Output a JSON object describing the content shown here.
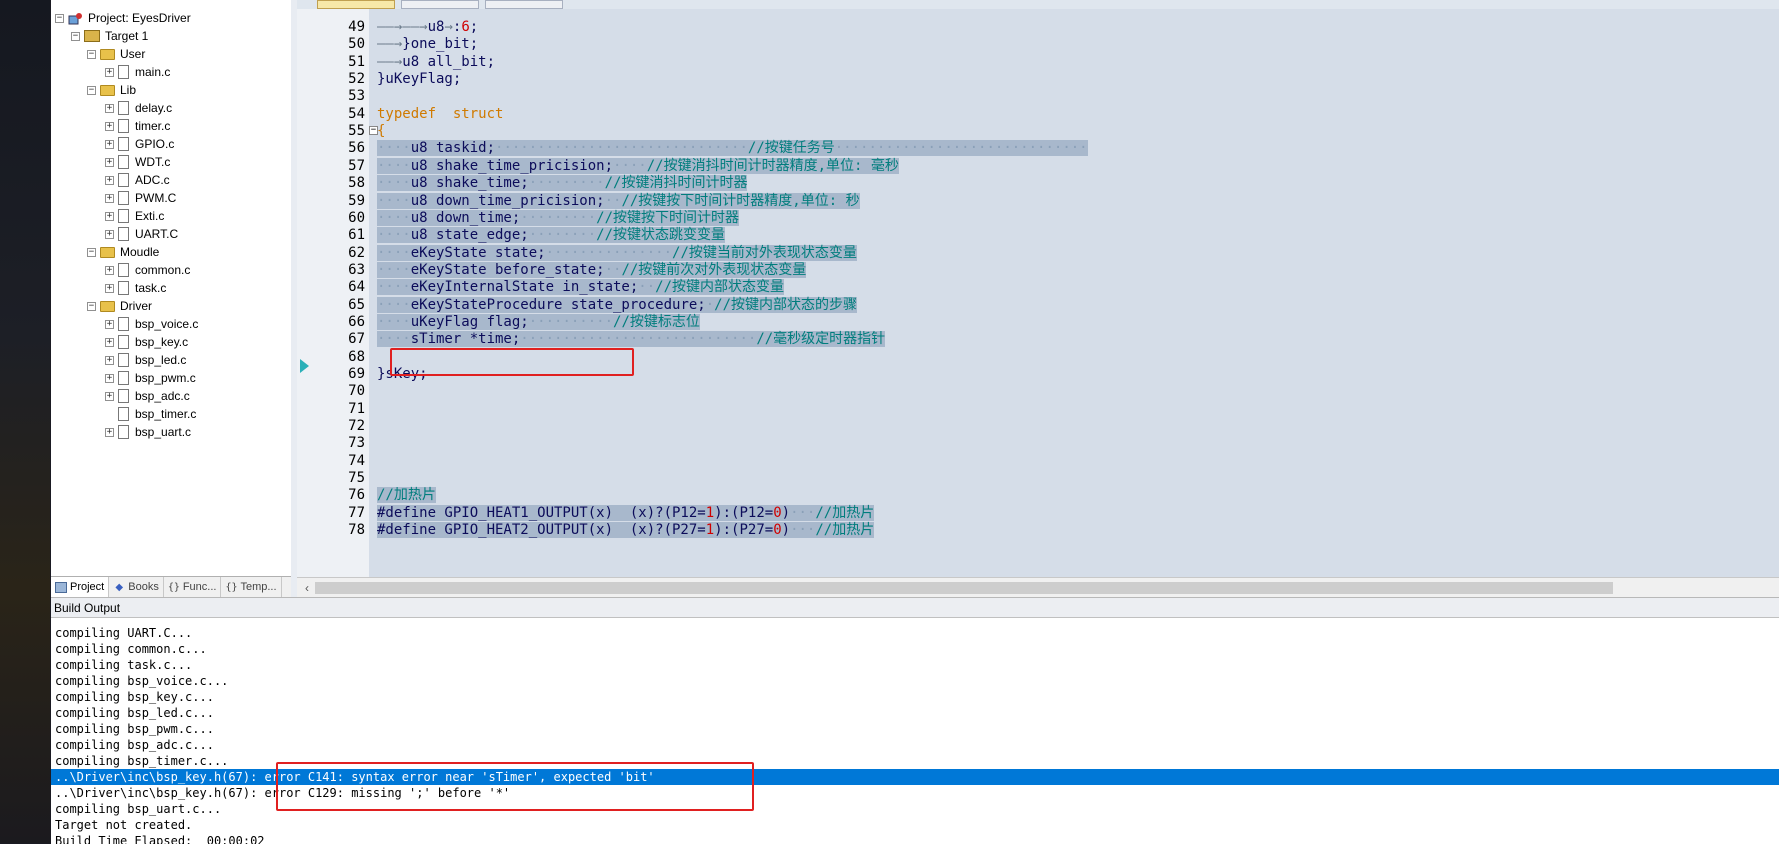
{
  "project": {
    "root_label": "Project: EyesDriver",
    "target_label": "Target 1",
    "groups": [
      {
        "name": "User",
        "files": [
          "main.c"
        ]
      },
      {
        "name": "Lib",
        "files": [
          "delay.c",
          "timer.c",
          "GPIO.c",
          "WDT.c",
          "ADC.c",
          "PWM.C",
          "Exti.c",
          "UART.C"
        ]
      },
      {
        "name": "Moudle",
        "files": [
          "common.c",
          "task.c"
        ]
      },
      {
        "name": "Driver",
        "files": [
          "bsp_voice.c",
          "bsp_key.c",
          "bsp_led.c",
          "bsp_pwm.c",
          "bsp_adc.c",
          "bsp_timer.c",
          "bsp_uart.c"
        ]
      }
    ],
    "tabs": [
      "Project",
      "Books",
      "Func...",
      "Temp..."
    ]
  },
  "editor": {
    "line_numbers": [
      "49",
      "50",
      "51",
      "52",
      "53",
      "54",
      "55",
      "56",
      "57",
      "58",
      "59",
      "60",
      "61",
      "62",
      "63",
      "64",
      "65",
      "66",
      "67",
      "68",
      "69",
      "70",
      "71",
      "72",
      "73",
      "74",
      "75",
      "76",
      "77",
      "78"
    ],
    "lines": {
      "l49": {
        "code": "u8",
        "op": ":",
        "num": "6",
        "end": ";"
      },
      "l50": {
        "code": "}one_bit;"
      },
      "l51": {
        "code": "u8 all_bit;"
      },
      "l52": {
        "code": "}uKeyFlag;"
      },
      "l54": {
        "kw1": "typedef",
        "kw2": "struct"
      },
      "l55": {
        "code": "{"
      },
      "l56": {
        "code": "u8 taskid;",
        "comment": "//按键任务号"
      },
      "l57": {
        "code": "u8 shake_time_pricision;",
        "comment": "//按键消抖时间计时器精度,单位: 毫秒"
      },
      "l58": {
        "code": "u8 shake_time;",
        "comment": "//按键消抖时间计时器"
      },
      "l59": {
        "code": "u8 down_time_pricision;",
        "comment": "//按键按下时间计时器精度,单位: 秒"
      },
      "l60": {
        "code": "u8 down_time;",
        "comment": "//按键按下时间计时器"
      },
      "l61": {
        "code": "u8 state_edge;",
        "comment": "//按键状态跳变变量"
      },
      "l62": {
        "code": "eKeyState state;",
        "comment": "//按键当前对外表现状态变量"
      },
      "l63": {
        "code": "eKeyState before_state;",
        "comment": "//按键前次对外表现状态变量"
      },
      "l64": {
        "code": "eKeyInternalState in_state;",
        "comment": "//按键内部状态变量"
      },
      "l65": {
        "code": "eKeyStateProcedure state_procedure;",
        "comment": "//按键内部状态的步骤"
      },
      "l66": {
        "code": "uKeyFlag flag;",
        "comment": "//按键标志位"
      },
      "l67": {
        "code": "sTimer *time;",
        "comment": "//毫秒级定时器指针"
      },
      "l69": {
        "code": "}sKey;"
      },
      "l76": {
        "comment": "//加热片"
      },
      "l77": {
        "define": "#define GPIO_HEAT1_OUTPUT(x)  (x)?(P12=",
        "n1": "1",
        "mid": "):(P12=",
        "n2": "0",
        "end": ")",
        "comment": "//加热片"
      },
      "l78": {
        "define": "#define GPIO_HEAT2_OUTPUT(x)  (x)?(P27=",
        "n1": "1",
        "mid": "):(P27=",
        "n2": "0",
        "end": ")",
        "comment": "//加热片"
      }
    }
  },
  "build_output": {
    "title": "Build Output",
    "lines": [
      "compiling UART.C...",
      "compiling common.c...",
      "compiling task.c...",
      "compiling bsp_voice.c...",
      "compiling bsp_key.c...",
      "compiling bsp_led.c...",
      "compiling bsp_pwm.c...",
      "compiling bsp_adc.c...",
      "compiling bsp_timer.c...",
      "..\\Driver\\inc\\bsp_key.h(67): error C141: syntax error near 'sTimer', expected 'bit'",
      "..\\Driver\\inc\\bsp_key.h(67): error C129: missing ';' before '*'",
      "compiling bsp_uart.c...",
      "Target not created.",
      "Build Time Elapsed:  00:00:02"
    ]
  },
  "colors": {
    "selection": "#0078d7",
    "highlight_box": "#e02020",
    "comment": "#007d7d",
    "keyword": "#d07a00"
  }
}
